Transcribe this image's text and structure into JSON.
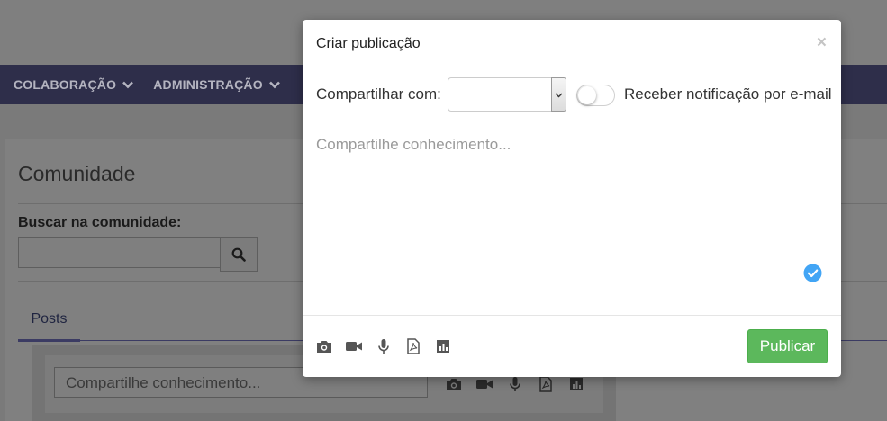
{
  "nav": {
    "items": [
      {
        "label": "COLABORAÇÃO"
      },
      {
        "label": "ADMINISTRAÇÃO"
      }
    ]
  },
  "community": {
    "title": "Comunidade",
    "search_label": "Buscar na comunidade:",
    "search_value": "",
    "tabs": [
      {
        "label": "Posts"
      }
    ],
    "post_placeholder": "Compartilhe conhecimento..."
  },
  "modal": {
    "title": "Criar publicação",
    "close_label": "×",
    "share_label": "Compartilhar com:",
    "share_value": "",
    "notify_label": "Receber notificação por e-mail",
    "notify_on": false,
    "post_placeholder": "Compartilhe conhecimento...",
    "post_value": "",
    "publish_label": "Publicar",
    "footer_icons": [
      "camera-icon",
      "video-icon",
      "microphone-icon",
      "pdf-icon",
      "chart-icon"
    ]
  },
  "colors": {
    "navbar": "#2e2e4a",
    "accent": "#3b3b63",
    "publish": "#5cb85c",
    "check": "#42a5f5"
  }
}
